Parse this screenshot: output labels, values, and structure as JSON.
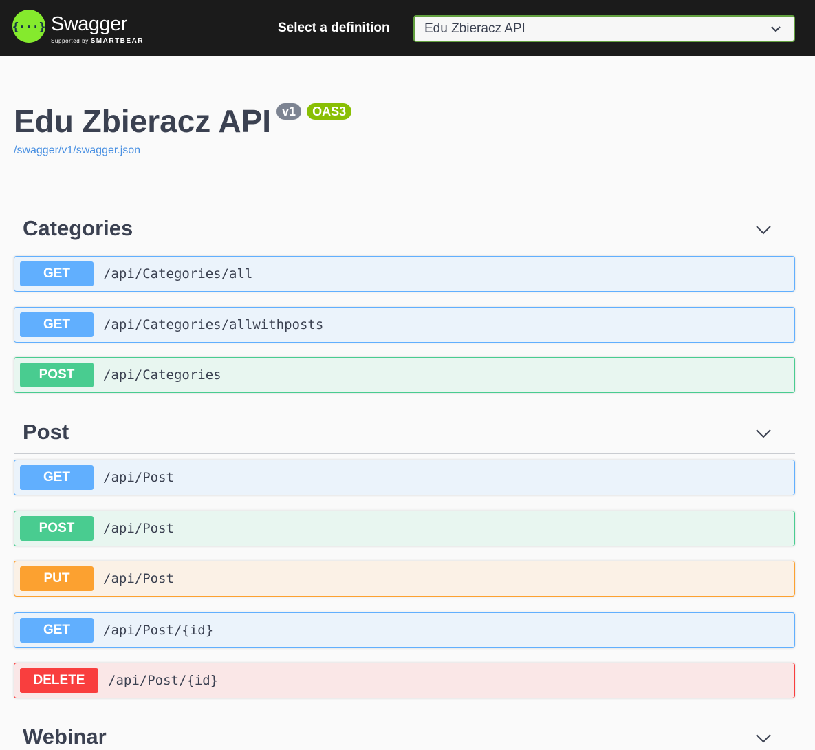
{
  "topbar": {
    "logo_glyph": "{···}",
    "logo_name": "Swagger",
    "logo_sub_prefix": "Supported by",
    "logo_sub_brand": "SMARTBEAR",
    "select_label": "Select a definition",
    "selected_definition": "Edu Zbieracz API"
  },
  "info": {
    "title": "Edu Zbieracz API",
    "version_badge": "v1",
    "oas_badge": "OAS3",
    "spec_link": "/swagger/v1/swagger.json"
  },
  "sections": [
    {
      "name": "Categories",
      "operations": [
        {
          "method": "GET",
          "path": "/api/Categories/all"
        },
        {
          "method": "GET",
          "path": "/api/Categories/allwithposts"
        },
        {
          "method": "POST",
          "path": "/api/Categories"
        }
      ]
    },
    {
      "name": "Post",
      "operations": [
        {
          "method": "GET",
          "path": "/api/Post"
        },
        {
          "method": "POST",
          "path": "/api/Post"
        },
        {
          "method": "PUT",
          "path": "/api/Post"
        },
        {
          "method": "GET",
          "path": "/api/Post/{id}"
        },
        {
          "method": "DELETE",
          "path": "/api/Post/{id}"
        }
      ]
    },
    {
      "name": "Webinar",
      "operations": []
    }
  ],
  "colors": {
    "get": "#61affe",
    "post": "#49cc90",
    "put": "#fca130",
    "delete": "#f93e3e",
    "topbar": "#1b1b1b",
    "logo": "#85ea2d"
  },
  "icons": {
    "dropdown": "chevron-down-icon",
    "section_toggle": "chevron-down-icon"
  }
}
